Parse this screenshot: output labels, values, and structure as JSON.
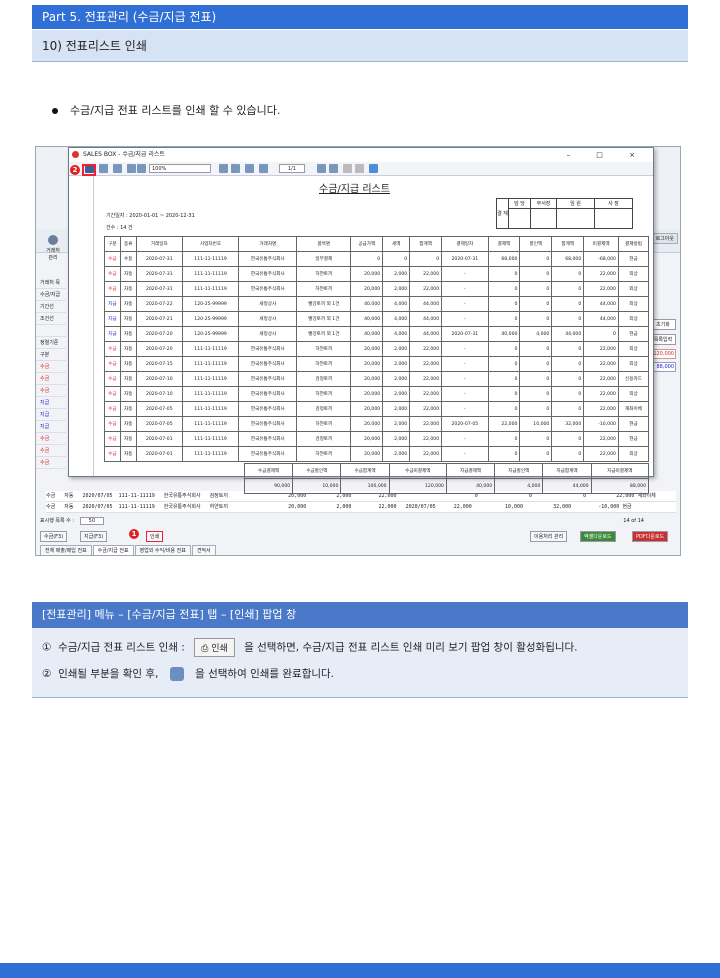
{
  "header": {
    "part_title": "Part 5. 전표관리 (수금/지급 전표)",
    "section_title": "10) 전표리스트 인쇄"
  },
  "bullet_text": "수금/지급 전표 리스트를 인쇄 할 수 있습니다.",
  "popup": {
    "window_title": "SALES BOX - 수금/지급 리스트",
    "zoom": "100%",
    "page": "1/1",
    "report_title": "수금/지급 리스트",
    "approval": {
      "side": "결 재",
      "cols": [
        "담 당",
        "부서장",
        "임 원",
        "사 장"
      ]
    },
    "period": "기간일자 : 2020-01-01 ~ 2020-12-31",
    "count": "건수 : 14 건",
    "columns": [
      "구분",
      "종류",
      "거래일자",
      "사업자번호",
      "거래처명",
      "품목명",
      "공급가액",
      "세액",
      "합계액",
      "결제일자",
      "결제액",
      "할인액",
      "합계액",
      "미결제액",
      "결제방법"
    ],
    "rows": [
      [
        "수금",
        "수동",
        "2020-07-31",
        "111-11-11119",
        "한국유통주식회사",
        "일부결제",
        "0",
        "0",
        "0",
        "2020-07-31",
        "68,000",
        "0",
        "68,000",
        "-68,000",
        "현금"
      ],
      [
        "수금",
        "자동",
        "2020-07-31",
        "111-11-11119",
        "한국유통주식회사",
        "하얀토끼",
        "20,000",
        "2,000",
        "22,000",
        "-",
        "0",
        "0",
        "0",
        "22,000",
        "외상"
      ],
      [
        "수금",
        "자동",
        "2020-07-31",
        "111-11-11119",
        "한국유통주식회사",
        "하얀토끼",
        "20,000",
        "2,000",
        "22,000",
        "-",
        "0",
        "0",
        "0",
        "22,000",
        "외상"
      ],
      [
        "지급",
        "자동",
        "2020-07-22",
        "120-25-99999",
        "세정상사",
        "빨강토끼 외 1건",
        "40,000",
        "4,000",
        "44,000",
        "-",
        "0",
        "0",
        "0",
        "44,000",
        "외상"
      ],
      [
        "지급",
        "자동",
        "2020-07-21",
        "120-25-99999",
        "세정상사",
        "빨강토끼 외 1건",
        "40,000",
        "4,000",
        "44,000",
        "-",
        "0",
        "0",
        "0",
        "44,000",
        "외상"
      ],
      [
        "지급",
        "자동",
        "2020-07-20",
        "120-25-99999",
        "세정상사",
        "빨강토끼 외 1건",
        "40,000",
        "4,000",
        "44,000",
        "2020-07-31",
        "40,000",
        "4,000",
        "44,000",
        "0",
        "현금"
      ],
      [
        "수금",
        "자동",
        "2020-07-20",
        "111-11-11119",
        "한국유통주식회사",
        "하얀토끼",
        "20,000",
        "2,000",
        "22,000",
        "-",
        "0",
        "0",
        "0",
        "22,000",
        "외상"
      ],
      [
        "수금",
        "자동",
        "2020-07-15",
        "111-11-11119",
        "한국유통주식회사",
        "하얀토끼",
        "20,000",
        "2,000",
        "22,000",
        "-",
        "0",
        "0",
        "0",
        "22,000",
        "외상"
      ],
      [
        "수금",
        "자동",
        "2020-07-10",
        "111-11-11119",
        "한국유통주식회사",
        "검정토끼",
        "20,000",
        "2,000",
        "22,000",
        "-",
        "0",
        "0",
        "0",
        "22,000",
        "신용카드"
      ],
      [
        "수금",
        "자동",
        "2020-07-10",
        "111-11-11119",
        "한국유통주식회사",
        "하얀토끼",
        "20,000",
        "2,000",
        "22,000",
        "-",
        "0",
        "0",
        "0",
        "22,000",
        "외상"
      ],
      [
        "수금",
        "자동",
        "2020-07-05",
        "111-11-11119",
        "한국유통주식회사",
        "검정토끼",
        "20,000",
        "2,000",
        "22,000",
        "-",
        "0",
        "0",
        "0",
        "22,000",
        "계좌이체"
      ],
      [
        "수금",
        "자동",
        "2020-07-05",
        "111-11-11119",
        "한국유통주식회사",
        "하얀토끼",
        "20,000",
        "2,000",
        "22,000",
        "2020-07-05",
        "22,000",
        "10,000",
        "32,000",
        "-10,000",
        "현금"
      ],
      [
        "수금",
        "자동",
        "2020-07-01",
        "111-11-11119",
        "한국유통주식회사",
        "검정토끼",
        "20,000",
        "2,000",
        "22,000",
        "-",
        "0",
        "0",
        "0",
        "22,000",
        "현금"
      ],
      [
        "수금",
        "자동",
        "2020-07-01",
        "111-11-11119",
        "한국유통주식회사",
        "하얀토끼",
        "20,000",
        "2,000",
        "22,000",
        "-",
        "0",
        "0",
        "0",
        "22,000",
        "외상"
      ]
    ],
    "summary_headers": [
      "수금결제액",
      "수금할인액",
      "수금합계액",
      "수금미결제액",
      "지급결제액",
      "지급할인액",
      "지급합계액",
      "지급미결제액"
    ],
    "summary_values": [
      "90,000",
      "10,000",
      "100,000",
      "120,000",
      "40,000",
      "4,000",
      "44,000",
      "88,000"
    ]
  },
  "bg_app": {
    "logout": "로그아웃",
    "left_items": [
      "거래처 관리",
      "거래처 목",
      "수금/지급",
      "기간선",
      "조건선",
      "",
      "정렬기준",
      "구분",
      "수금",
      "수금",
      "수금",
      "지급",
      "지급",
      "지급",
      "수금",
      "수금",
      "수금"
    ],
    "right_buttons": [
      "초기화",
      "목록입력"
    ],
    "right_nums": [
      "120,000",
      "88,000"
    ],
    "bg_rows": [
      "수금   자동   2020/07/05  111-11-11119   한국유통주식회사   검정토끼                    20,000          2,000         22,000                          0                 0                 0          22,000 계좌이체",
      "수금   자동   2020/07/05  111-11-11119   한국유통주식회사   하얀토끼                    20,000          2,000         22,000   2020/07/05      22,000           10,000          32,000         -10,000 현금"
    ],
    "page_size_label": "표시행 목록 수 :",
    "page_size": "50",
    "pager": "14 of 14",
    "buttons": {
      "collect": "수금(F3)",
      "pay": "지급(F3)",
      "print": "인쇄",
      "misc": "이용처리 관리",
      "excel": "엑셀다운로드",
      "pdf": "PDF다운로드"
    },
    "tabs": [
      "전체 매출/매입 전표",
      "수금/지급 전표",
      "영업외 수익/비용 전표",
      "견적서"
    ]
  },
  "note": {
    "title": "[전표관리] 메뉴 – [수금/지급 전표] 탭 – [인쇄] 팝업 창",
    "line1_num": "①",
    "line1_pre": "수금/지급 전표 리스트 인쇄 :",
    "line1_btn": "인쇄",
    "line1_post": "을 선택하면, 수금/지급 전표 리스트 인쇄 미리 보기 팝업 창이 활성화됩니다.",
    "line2_num": "②",
    "line2_pre": "인쇄될 부분을 확인 후,",
    "line2_post": "을 선택하여 인쇄를 완료합니다."
  },
  "badges": {
    "one": "1",
    "two": "2"
  }
}
